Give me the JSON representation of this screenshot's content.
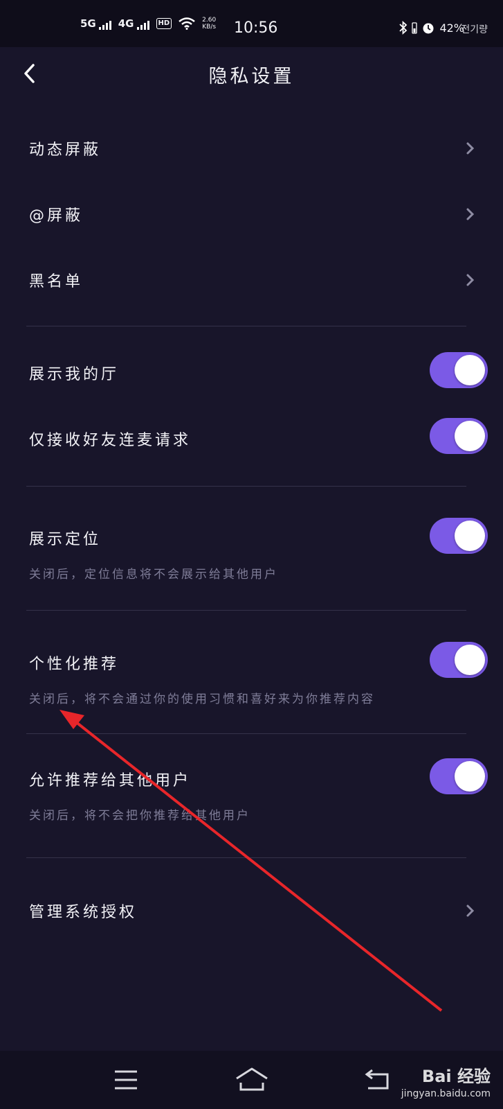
{
  "status_bar": {
    "net1": "5G",
    "net2": "4G",
    "hd": "HD",
    "speed_value": "2.60",
    "speed_unit": "KB/s",
    "time": "10:56",
    "battery": "42%",
    "carrier": "전기량"
  },
  "header": {
    "title": "隐私设置"
  },
  "menu_items": [
    {
      "label": "动态屏蔽"
    },
    {
      "label": "@屏蔽"
    },
    {
      "label": "黑名单"
    }
  ],
  "toggles": [
    {
      "label": "展示我的厅",
      "on": true
    },
    {
      "label": "仅接收好友连麦请求",
      "on": true
    },
    {
      "label": "展示定位",
      "description": "关闭后，定位信息将不会展示给其他用户",
      "on": true
    },
    {
      "label": "个性化推荐",
      "description": "关闭后，将不会通过你的使用习惯和喜好来为你推荐内容",
      "on": true
    },
    {
      "label": "允许推荐给其他用户",
      "description": "关闭后，将不会把你推荐给其他用户",
      "on": true
    }
  ],
  "manage": {
    "label": "管理系统授权"
  },
  "colors": {
    "background": "#18152a",
    "toggle_on": "#7b5ae6",
    "annotation_arrow": "#e8262a"
  },
  "watermark": {
    "brand": "Bai 经验",
    "url": "jingyan.baidu.com"
  }
}
